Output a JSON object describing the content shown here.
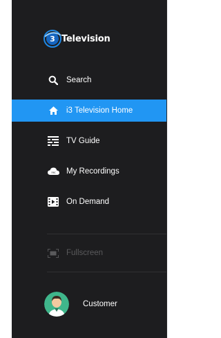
{
  "brand": {
    "name": "Television",
    "logo_mark": "i3",
    "accent": "#2196f3"
  },
  "nav": {
    "items": [
      {
        "label": "Search",
        "icon": "search-icon"
      },
      {
        "label": "i3 Television Home",
        "icon": "home-icon",
        "active": true
      },
      {
        "label": "TV Guide",
        "icon": "tv-guide-icon"
      },
      {
        "label": "My Recordings",
        "icon": "cloud-icon"
      },
      {
        "label": "On Demand",
        "icon": "film-icon"
      }
    ],
    "fullscreen": {
      "label": "Fullscreen",
      "icon": "fullscreen-icon",
      "disabled": true
    }
  },
  "user": {
    "name": "Customer",
    "icon": "avatar"
  },
  "colors": {
    "sidebar_bg": "#1d1d1f",
    "active_bg": "#2196f3",
    "disabled_text": "#5a5a5c"
  }
}
